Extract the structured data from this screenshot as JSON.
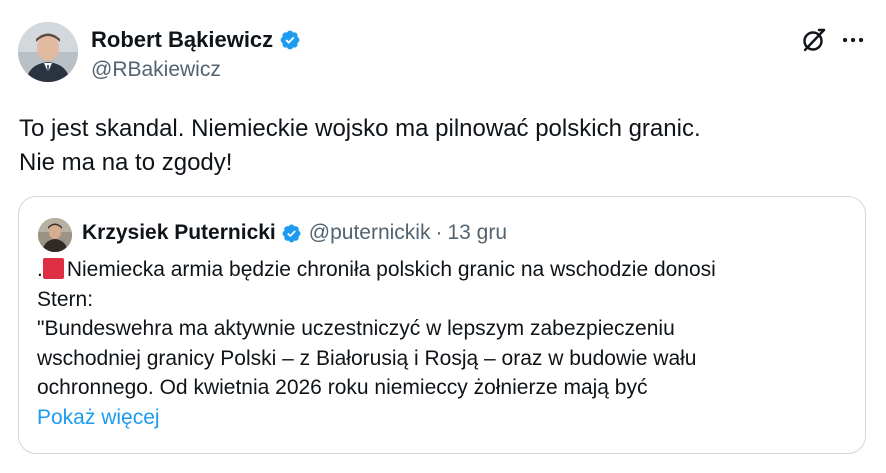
{
  "author": {
    "name": "Robert Bąkiewicz",
    "handle": "@RBakiewicz",
    "verified": true
  },
  "tweet": {
    "lines": [
      "To jest skandal. Niemieckie wojsko ma pilnować polskich granic.",
      "Nie ma na to zgody!"
    ]
  },
  "quoted": {
    "name": "Krzysiek Puternicki",
    "handle": "@puternickik",
    "separator": "·",
    "date": "13 gru",
    "verified": true,
    "lead_char": ".",
    "lines": [
      "Niemiecka armia będzie chroniła polskich granic na wschodzie donosi",
      "Stern:",
      "\"Bundeswehra ma aktywnie uczestniczyć w lepszym zabezpieczeniu",
      "wschodniej granicy Polski – z Białorusią i Rosją – oraz w budowie wału",
      "ochronnego. Od kwietnia 2026 roku niemieccy żołnierze mają być"
    ],
    "show_more": "Pokaż więcej"
  },
  "icons": {
    "verified": "verified-badge-icon",
    "grok": "grok-icon",
    "more": "more-options-icon"
  },
  "colors": {
    "accent": "#1d9bf0",
    "text": "#0f1419",
    "secondary": "#536471",
    "border": "#cfd9de"
  }
}
